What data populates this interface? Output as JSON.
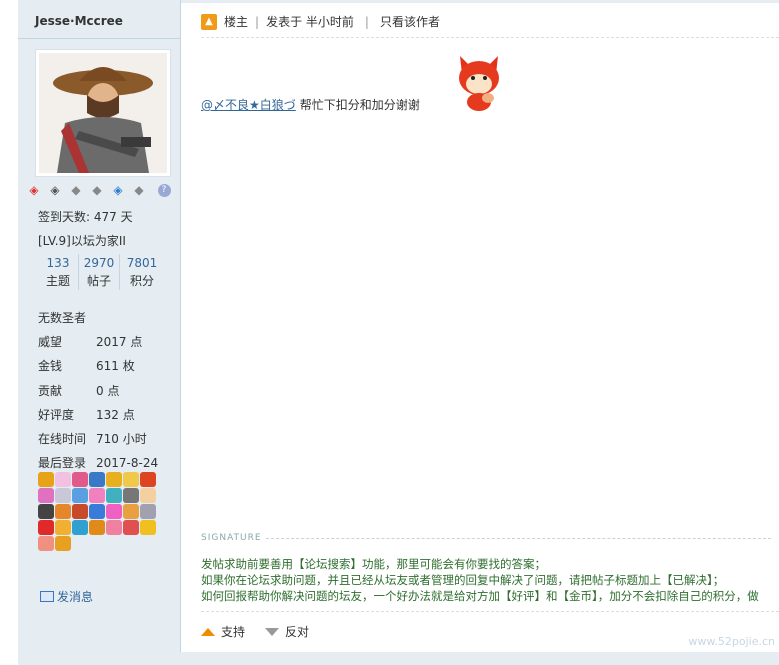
{
  "user": {
    "name": "Jesse·Mccree",
    "checkin": "签到天数: 477 天",
    "level": "[LV.9]以坛为家II",
    "counts": [
      {
        "num": "133",
        "label": "主题"
      },
      {
        "num": "2970",
        "label": "帖子"
      },
      {
        "num": "7801",
        "label": "积分"
      }
    ],
    "title": "无数圣者",
    "profile": [
      {
        "k": "威望",
        "v": "2017 点"
      },
      {
        "k": "金钱",
        "v": "611 枚"
      },
      {
        "k": "贡献",
        "v": "0 点"
      },
      {
        "k": "好评度",
        "v": "132 点"
      },
      {
        "k": "在线时间",
        "v": "710 小时"
      },
      {
        "k": "最后登录",
        "v": "2017-8-24"
      }
    ],
    "send_message": "发消息"
  },
  "post": {
    "owner_label": "楼主",
    "posted_at": "发表于 半小时前",
    "only_author": "只看该作者",
    "mention": "@〆不良★白狼づ",
    "body_text": "帮忙下扣分和加分谢谢"
  },
  "signature": {
    "label": "SIGNATURE",
    "lines": [
      "发帖求助前要善用【论坛搜索】功能，那里可能会有你要找的答案；",
      "如果你在论坛求助问题，并且已经从坛友或者管理的回复中解决了问题，请把帖子标题加上【已解决】；",
      "如何回报帮助你解决问题的坛友，一个好办法就是给对方加【好评】和【金币】，加分不会扣除自己的积分，做"
    ]
  },
  "actions": {
    "support": "支持",
    "oppose": "反对"
  },
  "watermark": "www.52pojie.cn",
  "colors": {
    "sidebar_bg": "#e5edf2",
    "link": "#336699",
    "signature_text": "#2e6e2e",
    "support_arrow": "#f08a00"
  }
}
